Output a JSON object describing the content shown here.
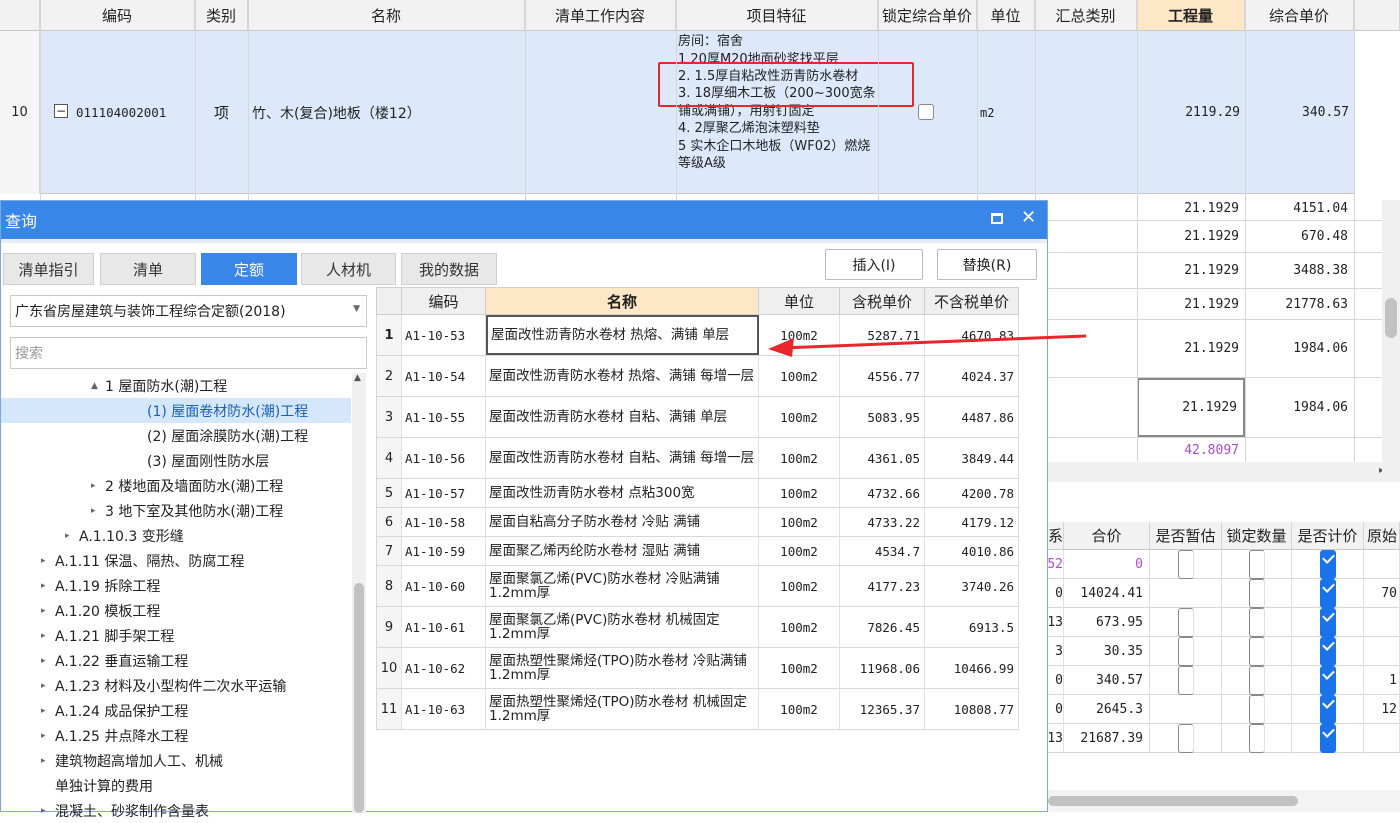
{
  "top_grid": {
    "headers": [
      "编码",
      "类别",
      "名称",
      "清单工作内容",
      "项目特征",
      "锁定综合单价",
      "单位",
      "汇总类别",
      "工程量",
      "综合单价"
    ],
    "row": {
      "index": "10",
      "code": "011104002001",
      "type": "项",
      "name": "竹、木(复合)地板（楼12）",
      "features": [
        "房间：宿舍",
        "1  20厚M20地面砂浆找平层",
        "2.  1.5厚自粘改性沥青防水卷材",
        "3.  18厚细木工板（200~300宽条铺或满铺），用射钉固定",
        "4.  2厚聚乙烯泡沫塑料垫",
        "5  实木企口木地板（WF02）燃烧等级A级"
      ],
      "unit": "m2",
      "quantity": "2119.29",
      "unit_price": "340.57"
    }
  },
  "right_grid": {
    "rows": [
      {
        "qty": "21.1929",
        "price": "4151.04"
      },
      {
        "qty": "21.1929",
        "price": "670.48"
      },
      {
        "qty": "21.1929",
        "price": "3488.38"
      },
      {
        "qty": "21.1929",
        "price": "21778.63"
      },
      {
        "qty": "21.1929",
        "price": "1984.06"
      },
      {
        "qty": "21.1929",
        "price": "1984.06"
      },
      {
        "qty": "42.8097",
        "price": ""
      }
    ]
  },
  "dialog": {
    "title": "查询",
    "tabs": [
      "清单指引",
      "清单",
      "定额",
      "人材机",
      "我的数据"
    ],
    "insert_label": "插入(I)",
    "replace_label": "替换(R)",
    "quota_select": "广东省房屋建筑与装饰工程综合定额(2018)",
    "search_placeholder": "搜索",
    "tree": [
      {
        "label": "1 屋面防水(潮)工程",
        "level": 3,
        "toggle": "▲"
      },
      {
        "label": "(1) 屋面卷材防水(潮)工程",
        "level": 5,
        "toggle": "",
        "selected": true
      },
      {
        "label": "(2) 屋面涂膜防水(潮)工程",
        "level": 5,
        "toggle": ""
      },
      {
        "label": "(3) 屋面刚性防水层",
        "level": 5,
        "toggle": ""
      },
      {
        "label": "2 楼地面及墙面防水(潮)工程",
        "level": 3,
        "toggle": "▸"
      },
      {
        "label": "3 地下室及其他防水(潮)工程",
        "level": 3,
        "toggle": "▸"
      },
      {
        "label": "A.1.10.3 变形缝",
        "level": 2,
        "toggle": "▸"
      },
      {
        "label": "A.1.11 保温、隔热、防腐工程",
        "level": 1,
        "toggle": "▸"
      },
      {
        "label": "A.1.19 拆除工程",
        "level": 1,
        "toggle": "▸"
      },
      {
        "label": "A.1.20 模板工程",
        "level": 1,
        "toggle": "▸"
      },
      {
        "label": "A.1.21 脚手架工程",
        "level": 1,
        "toggle": "▸"
      },
      {
        "label": "A.1.22 垂直运输工程",
        "level": 1,
        "toggle": "▸"
      },
      {
        "label": "A.1.23 材料及小型构件二次水平运输",
        "level": 1,
        "toggle": "▸"
      },
      {
        "label": "A.1.24 成品保护工程",
        "level": 1,
        "toggle": "▸"
      },
      {
        "label": "A.1.25 井点降水工程",
        "level": 1,
        "toggle": "▸"
      },
      {
        "label": "建筑物超高增加人工、机械",
        "level": 1,
        "toggle": "▸"
      },
      {
        "label": "单独计算的费用",
        "level": 1,
        "toggle": ""
      },
      {
        "label": "混凝土、砂浆制作含量表",
        "level": 1,
        "toggle": "▸"
      }
    ],
    "table_headers": [
      "编码",
      "名称",
      "单位",
      "含税单价",
      "不含税单价"
    ],
    "rows": [
      {
        "no": "1",
        "code": "A1-10-53",
        "name": "屋面改性沥青防水卷材 热熔、满铺 单层",
        "unit": "100m2",
        "tax": "5287.71",
        "notax": "4670.83"
      },
      {
        "no": "2",
        "code": "A1-10-54",
        "name": "屋面改性沥青防水卷材 热熔、满铺 每增一层",
        "unit": "100m2",
        "tax": "4556.77",
        "notax": "4024.37"
      },
      {
        "no": "3",
        "code": "A1-10-55",
        "name": "屋面改性沥青防水卷材 自粘、满铺 单层",
        "unit": "100m2",
        "tax": "5083.95",
        "notax": "4487.86"
      },
      {
        "no": "4",
        "code": "A1-10-56",
        "name": "屋面改性沥青防水卷材 自粘、满铺 每增一层",
        "unit": "100m2",
        "tax": "4361.05",
        "notax": "3849.44"
      },
      {
        "no": "5",
        "code": "A1-10-57",
        "name": "屋面改性沥青防水卷材 点粘300宽",
        "unit": "100m2",
        "tax": "4732.66",
        "notax": "4200.78"
      },
      {
        "no": "6",
        "code": "A1-10-58",
        "name": "屋面自粘高分子防水卷材 冷贴 满铺",
        "unit": "100m2",
        "tax": "4733.22",
        "notax": "4179.12"
      },
      {
        "no": "7",
        "code": "A1-10-59",
        "name": "屋面聚乙烯丙纶防水卷材 湿贴 满铺",
        "unit": "100m2",
        "tax": "4534.7",
        "notax": "4010.86"
      },
      {
        "no": "8",
        "code": "A1-10-60",
        "name": "屋面聚氯乙烯(PVC)防水卷材 冷贴满铺 1.2mm厚",
        "unit": "100m2",
        "tax": "4177.23",
        "notax": "3740.26"
      },
      {
        "no": "9",
        "code": "A1-10-61",
        "name": "屋面聚氯乙烯(PVC)防水卷材 机械固定 1.2mm厚",
        "unit": "100m2",
        "tax": "7826.45",
        "notax": "6913.5"
      },
      {
        "no": "10",
        "code": "A1-10-62",
        "name": "屋面热塑性聚烯烃(TPO)防水卷材 冷贴满铺 1.2mm厚",
        "unit": "100m2",
        "tax": "11968.06",
        "notax": "10466.99"
      },
      {
        "no": "11",
        "code": "A1-10-63",
        "name": "屋面热塑性聚烯烃(TPO)防水卷材 机械固定 1.2mm厚",
        "unit": "100m2",
        "tax": "12365.37",
        "notax": "10808.77"
      }
    ]
  },
  "bottom_grid": {
    "headers": [
      "系",
      "合价",
      "是否暂估",
      "锁定数量",
      "是否计价",
      "原始"
    ],
    "rows": [
      {
        "a": "52",
        "total": "0",
        "est": true,
        "lock": true,
        "priced": true,
        "orig": ""
      },
      {
        "a": "0",
        "total": "14024.41",
        "est": false,
        "lock": true,
        "priced": true,
        "orig": "70"
      },
      {
        "a": "13",
        "total": "673.95",
        "est": true,
        "lock": true,
        "priced": true,
        "orig": ""
      },
      {
        "a": "3",
        "total": "30.35",
        "est": true,
        "lock": true,
        "priced": true,
        "orig": ""
      },
      {
        "a": "0",
        "total": "340.57",
        "est": true,
        "lock": true,
        "priced": true,
        "orig": "1"
      },
      {
        "a": "0",
        "total": "2645.3",
        "est": false,
        "lock": true,
        "priced": true,
        "orig": "12"
      },
      {
        "a": "13",
        "total": "21687.39",
        "est": true,
        "lock": true,
        "priced": true,
        "orig": ""
      }
    ]
  },
  "colors": {
    "accent": "#3886e8",
    "highlight_header": "#fde7c6",
    "annotation": "#e8262c",
    "selected_row": "#dde9fb"
  }
}
